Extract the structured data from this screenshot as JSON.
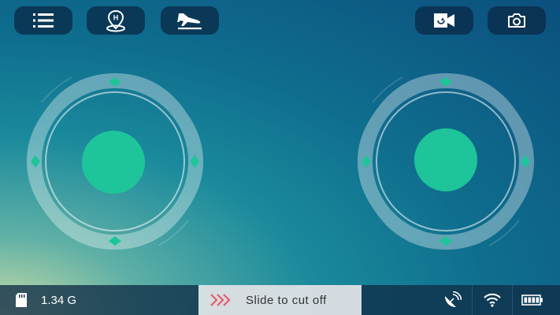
{
  "toolbar": {
    "left": [
      {
        "name": "menu",
        "icon": "list-icon"
      },
      {
        "name": "home",
        "icon": "home-point-icon"
      },
      {
        "name": "land",
        "icon": "landing-plane-icon"
      }
    ],
    "right": [
      {
        "name": "record",
        "icon": "video-camera-icon"
      },
      {
        "name": "photo",
        "icon": "camera-icon"
      }
    ]
  },
  "joysticks": {
    "left": {
      "name": "left-joystick"
    },
    "right": {
      "name": "right-joystick"
    }
  },
  "status": {
    "storage": "1.34 G",
    "slider_text": "Slide to cut off"
  },
  "colors": {
    "accent": "#1ec59a",
    "bar": "#0f2d46"
  }
}
